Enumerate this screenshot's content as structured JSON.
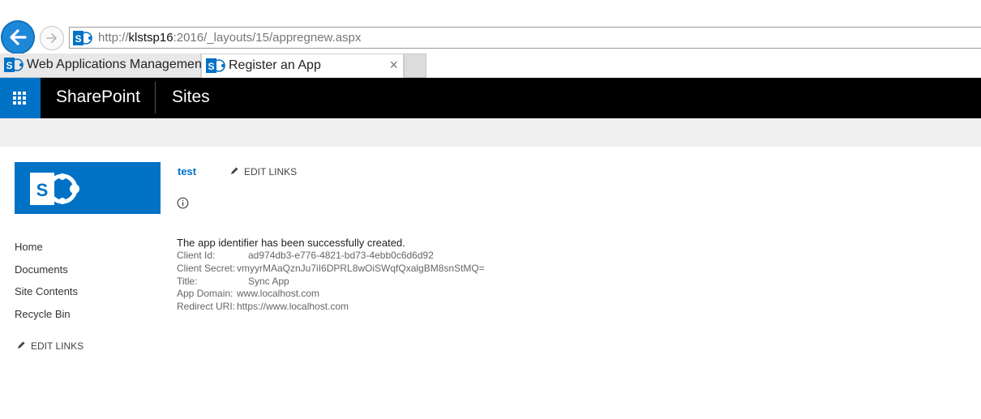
{
  "browser": {
    "url_prefix": "http://",
    "url_host": "klstsp16",
    "url_rest": ":2016/_layouts/15/appregnew.aspx",
    "tabs": [
      {
        "label": "Web Applications Management"
      },
      {
        "label": "Register an App",
        "close": "×"
      }
    ]
  },
  "suitebar": {
    "brand": "SharePoint",
    "sites_label": "Sites",
    "accent": "#0072c6"
  },
  "site": {
    "title": "test",
    "edit_links": "EDIT LINKS"
  },
  "quicklaunch": {
    "items": [
      {
        "label": "Home"
      },
      {
        "label": "Documents"
      },
      {
        "label": "Site Contents"
      },
      {
        "label": "Recycle Bin"
      }
    ],
    "edit_links": "EDIT LINKS"
  },
  "result": {
    "message": "The app identifier has been successfully created.",
    "fields": [
      {
        "label": "Client Id:",
        "value": "ad974db3-e776-4821-bd73-4ebb0c6d6d92"
      },
      {
        "label": "Client Secret:",
        "value": "vmyyrMAaQznJu7iI6DPRL8wOiSWqfQxalgBM8snStMQ="
      },
      {
        "label": "Title:",
        "value": "Sync App"
      },
      {
        "label": "App Domain:",
        "value": "www.localhost.com"
      },
      {
        "label": "Redirect URI:",
        "value": "https://www.localhost.com"
      }
    ]
  },
  "icons": {
    "back": "back-arrow-icon",
    "forward": "forward-arrow-icon",
    "favicon": "sharepoint-favicon-icon",
    "waffle": "app-launcher-icon",
    "edit": "pencil-icon",
    "info": "info-icon"
  }
}
